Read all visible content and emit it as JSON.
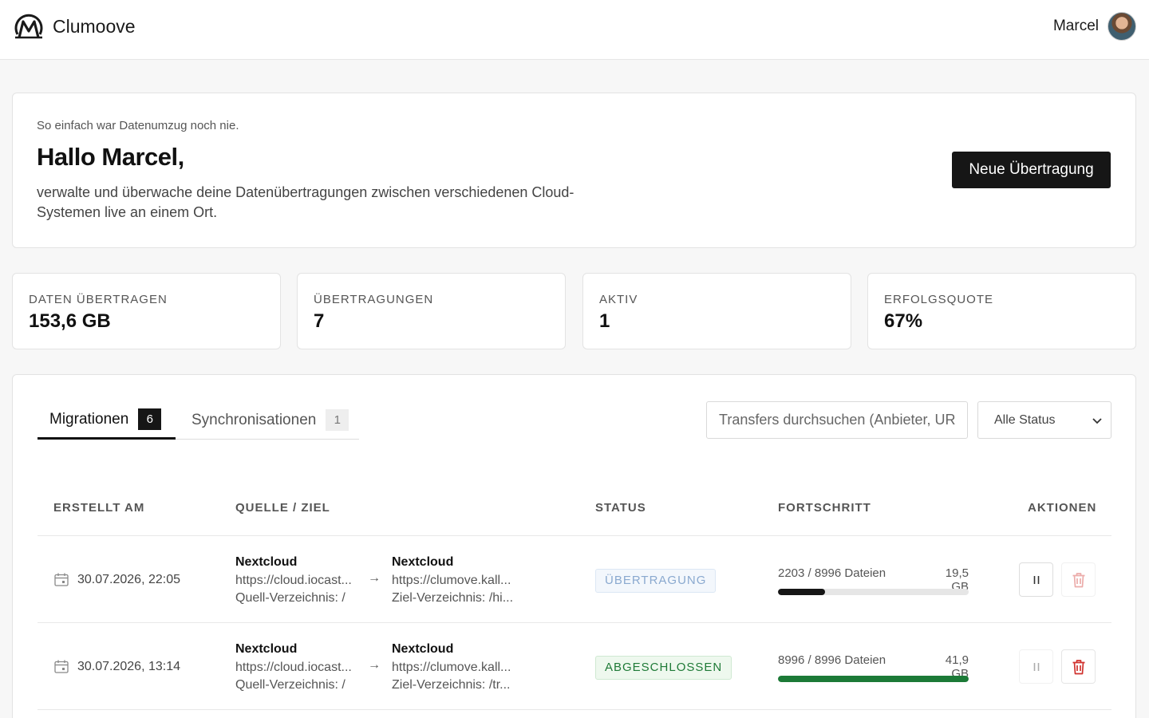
{
  "header": {
    "brand": "Clumoove",
    "user_name": "Marcel"
  },
  "hero": {
    "tagline": "So einfach war Datenumzug noch nie.",
    "greeting": "Hallo Marcel,",
    "description": "verwalte und überwache deine Datenübertragungen zwischen verschiedenen Cloud-Systemen live an einem Ort.",
    "new_transfer_label": "Neue Übertragung"
  },
  "stats": [
    {
      "label": "DATEN ÜBERTRAGEN",
      "value": "153,6 GB"
    },
    {
      "label": "ÜBERTRAGUNGEN",
      "value": "7"
    },
    {
      "label": "AKTIV",
      "value": "1"
    },
    {
      "label": "ERFOLGSQUOTE",
      "value": "67%"
    }
  ],
  "tabs": [
    {
      "label": "Migrationen",
      "count": "6",
      "active": true
    },
    {
      "label": "Synchronisationen",
      "count": "1",
      "active": false
    }
  ],
  "search": {
    "placeholder": "Transfers durchsuchen (Anbieter, URL, Verzeichnis)"
  },
  "status_filter": {
    "selected": "Alle Status"
  },
  "table": {
    "columns": [
      "ERSTELLT AM",
      "QUELLE / ZIEL",
      "STATUS",
      "FORTSCHRITT",
      "AKTIONEN"
    ],
    "rows": [
      {
        "created": "30.07.2026, 22:05",
        "source": {
          "provider": "Nextcloud",
          "url": "https://cloud.iocast...",
          "dir": "Quell-Verzeichnis: /"
        },
        "arrow": "→",
        "target": {
          "provider": "Nextcloud",
          "url": "https://clumove.kall...",
          "dir": "Ziel-Verzeichnis: /hi..."
        },
        "status": "ÜBERTRAGUNG",
        "status_kind": "info",
        "progress_text": "2203 / 8996 Dateien",
        "size": "19,5 GB",
        "progress": 0.245,
        "progress_color": "#161616",
        "pause_enabled": true,
        "delete_enabled": false
      },
      {
        "created": "30.07.2026, 13:14",
        "source": {
          "provider": "Nextcloud",
          "url": "https://cloud.iocast...",
          "dir": "Quell-Verzeichnis: /"
        },
        "arrow": "→",
        "target": {
          "provider": "Nextcloud",
          "url": "https://clumove.kall...",
          "dir": "Ziel-Verzeichnis: /tr..."
        },
        "status": "ABGESCHLOSSEN",
        "status_kind": "done",
        "progress_text": "8996 / 8996 Dateien",
        "size": "41,9 GB",
        "progress": 1.0,
        "progress_color": "#1c7a37",
        "pause_enabled": false,
        "delete_enabled": true
      }
    ]
  },
  "icons": {
    "logo": "clumoove-logo-icon",
    "calendar": "calendar-icon",
    "pause": "pause-icon",
    "delete": "trash-icon",
    "chevron": "chevron-down-icon"
  },
  "colors": {
    "primary": "#161616",
    "success": "#1c7a37",
    "danger": "#d0312d",
    "info": "#8aa9cf"
  }
}
